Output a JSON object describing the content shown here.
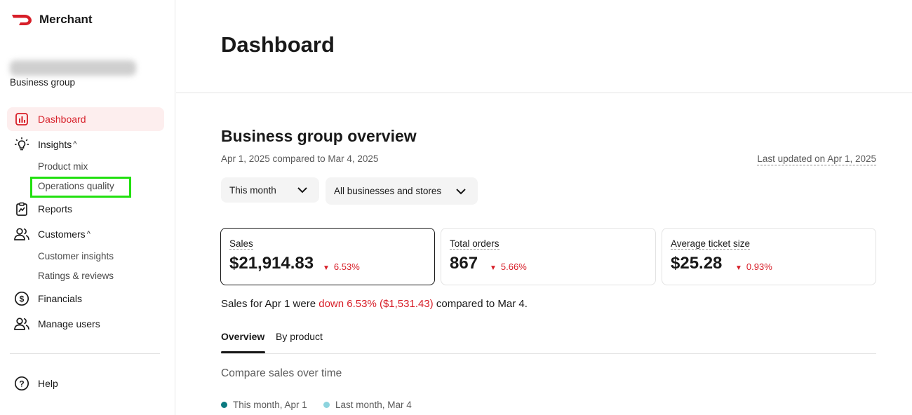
{
  "brand": {
    "name": "Merchant",
    "logo_color": "#d71e28"
  },
  "sidebar": {
    "group_label": "Business group",
    "nav": {
      "dashboard": "Dashboard",
      "insights": "Insights",
      "product_mix": "Product mix",
      "operations_quality": "Operations quality",
      "reports": "Reports",
      "customers": "Customers",
      "customer_insights": "Customer insights",
      "ratings_reviews": "Ratings & reviews",
      "financials": "Financials",
      "manage_users": "Manage users",
      "help": "Help"
    },
    "expand_glyph": "^"
  },
  "main": {
    "title": "Dashboard",
    "section_title": "Business group overview",
    "compare_date": "Apr 1, 2025 compared to Mar 4, 2025",
    "last_updated": "Last updated on Apr 1, 2025",
    "filters": {
      "period": "This month",
      "scope": "All businesses and stores"
    },
    "metrics": {
      "sales": {
        "label": "Sales",
        "value": "$21,914.83",
        "change": "6.53%"
      },
      "orders": {
        "label": "Total orders",
        "value": "867",
        "change": "5.66%"
      },
      "ticket": {
        "label": "Average ticket size",
        "value": "$25.28",
        "change": "0.93%"
      }
    },
    "summary": {
      "prefix": "Sales for Apr 1 were ",
      "highlight": "down 6.53% ($1,531.43)",
      "suffix": " compared to Mar 4."
    },
    "tabs": {
      "overview": "Overview",
      "by_product": "By product"
    },
    "compare_title": "Compare sales over time",
    "legend": {
      "this_month": "This month, Apr 1",
      "last_month": "Last month, Mar 4"
    }
  },
  "colors": {
    "accent_red": "#d71e28",
    "this_month_series": "#0b7a80",
    "last_month_series": "#8dd4de",
    "highlight_box": "#22e010"
  }
}
